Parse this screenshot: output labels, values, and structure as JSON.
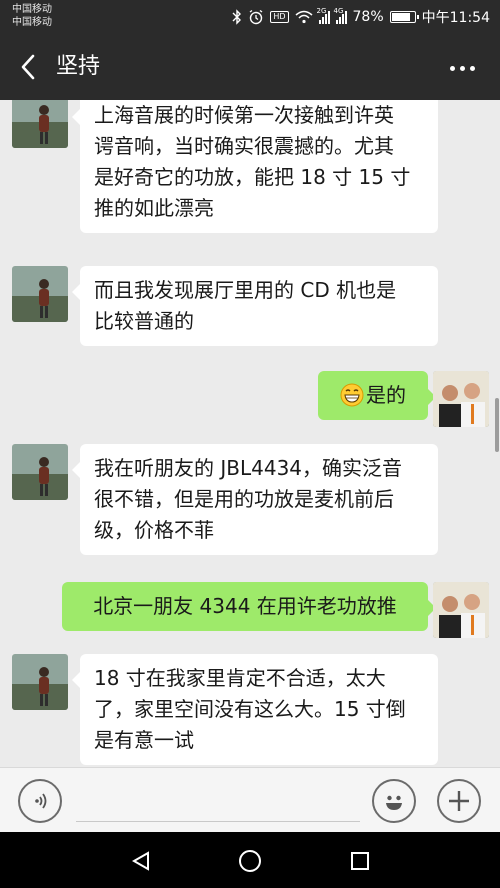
{
  "status_bar": {
    "carrier_1": "中国移动",
    "carrier_2": "中国移动",
    "hd_badge": "HD",
    "network_1": "2G",
    "network_2": "4G",
    "battery": "78%",
    "battery_level": 0.78,
    "time": "中午11:54",
    "icons": [
      "bluetooth-icon",
      "alarm-icon",
      "hd-icon",
      "wifi-icon",
      "signal-icon",
      "battery-icon"
    ]
  },
  "header": {
    "title": "坚持",
    "back_icon": "chevron-left-icon",
    "more_icon": "more-icon"
  },
  "messages": [
    {
      "sender": "them",
      "lines": [
        "上海音展的时候第一次接触到许英",
        "谔音响，当时确实很震撼的。尤其",
        "是好奇它的功放，能把 18 寸 15 寸",
        "推的如此漂亮"
      ]
    },
    {
      "sender": "them",
      "lines": [
        "而且我发现展厅里用的 CD 机也是",
        "比较普通的"
      ]
    },
    {
      "sender": "me",
      "emoji": "grin-emoji",
      "text": "是的"
    },
    {
      "sender": "them",
      "lines": [
        "我在听朋友的 JBL4434，确实泛音",
        "很不错，但是用的功放是麦机前后",
        "级，价格不菲"
      ]
    },
    {
      "sender": "me",
      "text": "北京一朋友 4344 在用许老功放推"
    },
    {
      "sender": "them",
      "lines": [
        "18 寸在我家里肯定不合适，太大",
        "了，家里空间没有这么大。15 寸倒",
        "是有意一试"
      ]
    }
  ],
  "input_bar": {
    "voice_icon": "voice-icon",
    "emoji_icon": "emoji-icon",
    "plus_icon": "plus-icon",
    "placeholder": ""
  },
  "nav_bar": {
    "icons": [
      "back-triangle-icon",
      "home-circle-icon",
      "recents-square-icon"
    ]
  },
  "colors": {
    "header_bg": "#2b2b2b",
    "chat_bg": "#ebebeb",
    "bubble_out": "#9eea6a",
    "bubble_in": "#ffffff"
  }
}
